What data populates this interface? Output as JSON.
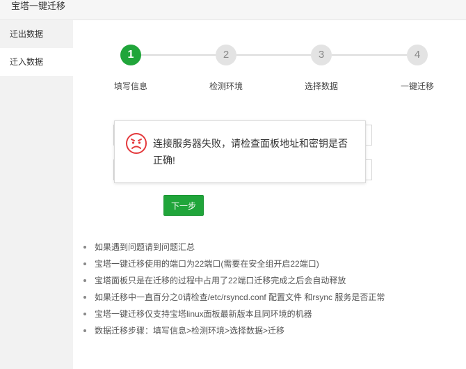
{
  "window": {
    "title": "宝塔一键迁移"
  },
  "sidebar": {
    "items": [
      {
        "label": "迁出数据"
      },
      {
        "label": "迁入数据"
      }
    ]
  },
  "steps": [
    {
      "number": "1",
      "label": "填写信息",
      "status": "active"
    },
    {
      "number": "2",
      "label": "检测环境",
      "status": "pending"
    },
    {
      "number": "3",
      "label": "选择数据",
      "status": "pending"
    },
    {
      "number": "4",
      "label": "一键迁移",
      "status": "pending"
    }
  ],
  "dialog": {
    "icon": "sad-face-icon",
    "message": "连接服务器失败，请检查面板地址和密钥是否正确!"
  },
  "actions": {
    "next_label": "下一步"
  },
  "tips": [
    "如果遇到问题请到问题汇总",
    "宝塔一键迁移使用的端口为22端口(需要在安全组开启22端口)",
    "宝塔面板只是在迁移的过程中占用了22端口迁移完成之后会自动释放",
    "如果迁移中一直百分之0请检查/etc/rsyncd.conf 配置文件 和rsync 服务是否正常",
    "宝塔一键迁移仅支持宝塔linux面板最新版本且同环境的机器",
    "数据迁移步骤：填写信息>检测环境>选择数据>迁移"
  ],
  "colors": {
    "accent": "#20a53a",
    "error_icon": "#e4393c",
    "step_inactive": "#e3e3e3"
  }
}
